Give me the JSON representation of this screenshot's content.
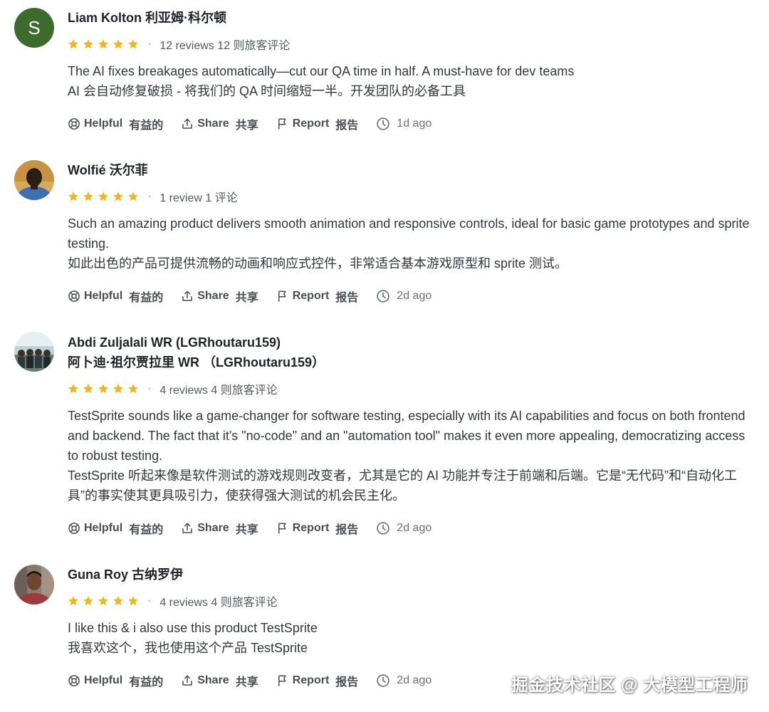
{
  "colors": {
    "star": "#f0b428",
    "avatar_s": "#3e6a2d"
  },
  "reviews": [
    {
      "name": "Liam Kolton  利亚姆·科尔顿",
      "avatar_letter": "S",
      "rating": 5,
      "count": "12 reviews  12 则旅客评论",
      "body": [
        "The AI fixes breakages automatically—cut our QA time in half. A must-have for dev teams",
        "AI 会自动修复破损 - 将我们的 QA 时间缩短一半。开发团队的必备工具"
      ],
      "time": "1d ago"
    },
    {
      "name": "Wolfié  沃尔菲",
      "rating": 5,
      "count": "1 review  1 评论",
      "body": [
        "Such an amazing product delivers smooth animation and responsive controls, ideal for basic game prototypes and sprite testing.",
        "如此出色的产品可提供流畅的动画和响应式控件，非常适合基本游戏原型和 sprite 测试。"
      ],
      "time": "2d ago"
    },
    {
      "name_lines": [
        "Abdi Zuljalali WR (LGRhoutaru159)",
        "阿卜迪·祖尔贾拉里 WR （LGRhoutaru159）"
      ],
      "rating": 5,
      "count": "4 reviews  4 则旅客评论",
      "body": [
        "TestSprite sounds like a game-changer for software testing, especially with its AI capabilities and focus on both frontend and backend. The fact that it's \"no-code\" and an \"automation tool\" makes it even more appealing, democratizing access to robust testing.",
        "TestSprite 听起来像是软件测试的游戏规则改变者，尤其是它的 AI 功能并专注于前端和后端。它是“无代码”和“自动化工具”的事实使其更具吸引力，使获得强大测试的机会民主化。"
      ],
      "time": "2d ago"
    },
    {
      "name": "Guna Roy  古纳罗伊",
      "rating": 5,
      "count": "4 reviews  4 则旅客评论",
      "body": [
        "I like this & i also use this product TestSprite",
        "我喜欢这个，我也使用这个产品 TestSprite"
      ],
      "time": "2d ago"
    }
  ],
  "actions": {
    "helpful": "Helpful",
    "helpful_zh": "有益的",
    "share": "Share",
    "share_zh": "共享",
    "report": "Report",
    "report_zh": "报告"
  },
  "separator": "·",
  "watermark": "掘金技术社区 @ 大模型工程师",
  "icons": [
    "star-icon",
    "lifebuoy-icon",
    "share-icon",
    "flag-icon",
    "clock-icon"
  ]
}
